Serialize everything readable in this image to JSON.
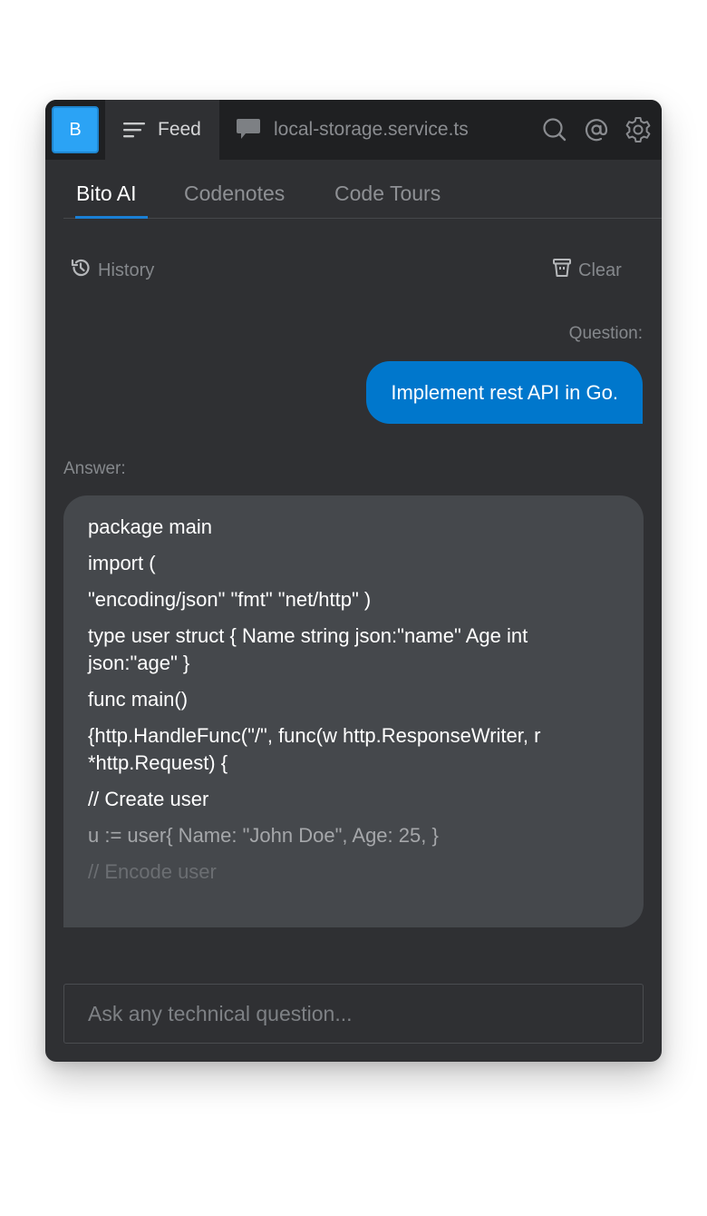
{
  "header": {
    "logo_letter": "B",
    "tabs": [
      {
        "label": "Feed",
        "icon": "menu-lines-icon",
        "active": true
      },
      {
        "label": "local-storage.service.ts",
        "icon": "chat-bubble-icon",
        "active": false
      }
    ],
    "actions": [
      {
        "icon": "search-icon"
      },
      {
        "icon": "mention-icon"
      },
      {
        "icon": "gear-icon"
      }
    ]
  },
  "subtabs": [
    {
      "label": "Bito AI",
      "active": true
    },
    {
      "label": "Codenotes",
      "active": false
    },
    {
      "label": "Code Tours",
      "active": false
    }
  ],
  "toolbar": {
    "history_label": "History",
    "clear_label": "Clear"
  },
  "conversation": {
    "question_label": "Question:",
    "question_text": "Implement rest API in Go.",
    "answer_label": "Answer:",
    "answer_lines": [
      "package main",
      "import (",
      "\"encoding/json\" \"fmt\" \"net/http\" )",
      "type user struct { Name string json:\"name\" Age int json:\"age\" }",
      "func main()",
      "{http.HandleFunc(\"/\", func(w http.ResponseWriter, r *http.Request) {",
      "// Create user",
      "u := user{ Name: \"John Doe\", Age: 25, }",
      "// Encode user"
    ]
  },
  "input": {
    "placeholder": "Ask any technical question...",
    "value": ""
  },
  "colors": {
    "accent": "#0077cc",
    "logo": "#2ba3f5",
    "panel_bg": "#2f3033",
    "header_bg": "#1f2022",
    "answer_bg": "#45484c"
  }
}
